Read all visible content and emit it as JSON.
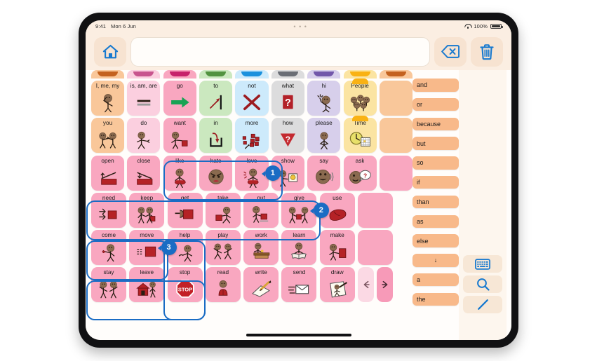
{
  "status_bar": {
    "time": "9:41",
    "date": "Mon 6 Jun",
    "center_dots": "• • •",
    "battery_percent": "100%",
    "wifi_icon": "wifi-icon",
    "battery_icon": "battery-icon"
  },
  "toolbar": {
    "home_icon": "home-icon",
    "message_value": "",
    "message_placeholder": "",
    "backspace_icon": "backspace-icon",
    "clear_icon": "trash-icon"
  },
  "tab_strip": [
    {
      "name": "pronouns",
      "body": "#f9c79a",
      "tab": "#c4621f"
    },
    {
      "name": "questions",
      "body": "#fbcfdf",
      "tab": "#c8558e"
    },
    {
      "name": "verbs",
      "body": "#f9a7c0",
      "tab": "#c7236b"
    },
    {
      "name": "prepositions",
      "body": "#cbe8bf",
      "tab": "#529340"
    },
    {
      "name": "negation",
      "body": "#cdeafb",
      "tab": "#1b91dd"
    },
    {
      "name": "questionwords",
      "body": "#dcdcdd",
      "tab": "#6a6e76"
    },
    {
      "name": "social",
      "body": "#d7cfeb",
      "tab": "#7257aa"
    },
    {
      "name": "people",
      "body": "#fbe4a2",
      "tab": "#f9b214"
    },
    {
      "name": "time",
      "body": "#f9c79a",
      "tab": "#c4621f"
    }
  ],
  "grid": {
    "rows": [
      [
        {
          "label": "I, me, my",
          "color": "#f9c79a",
          "icon": "person-pointing-self-icon"
        },
        {
          "label": "is, am, are",
          "color": "#fbcfdf",
          "icon": "equals-icon"
        },
        {
          "label": "go",
          "color": "#f9a7c0",
          "icon": "green-arrow-right-icon"
        },
        {
          "label": "to",
          "color": "#cbe8bf",
          "icon": "arrow-to-line-icon"
        },
        {
          "label": "not",
          "color": "#cdeafb",
          "icon": "red-x-icon"
        },
        {
          "label": "what",
          "color": "#dcdcdd",
          "icon": "red-question-square-icon"
        },
        {
          "label": "hi",
          "color": "#d7cfeb",
          "icon": "person-waving-icon"
        },
        {
          "label": "People",
          "color": "#fbe4a2",
          "icon": "group-of-people-icon",
          "folder": true,
          "tab": "#f9b214"
        },
        {
          "label": "",
          "color": "#f9c79a",
          "icon": "",
          "partial": true
        }
      ],
      [
        {
          "label": "you",
          "color": "#f9c79a",
          "icon": "two-people-pointing-icon"
        },
        {
          "label": "do",
          "color": "#fbcfdf",
          "icon": "person-doing-icon"
        },
        {
          "label": "want",
          "color": "#f9a7c0",
          "icon": "person-wanting-block-icon"
        },
        {
          "label": "in",
          "color": "#cbe8bf",
          "icon": "arrow-into-container-icon"
        },
        {
          "label": "more",
          "color": "#cdeafb",
          "icon": "more-blocks-icon"
        },
        {
          "label": "how",
          "color": "#dcdcdd",
          "icon": "red-question-triangle-icon"
        },
        {
          "label": "please",
          "color": "#d7cfeb",
          "icon": "person-pleading-icon"
        },
        {
          "label": "Time",
          "color": "#fbe4a2",
          "icon": "clock-calendar-icon",
          "folder": true,
          "tab": "#f9b214"
        },
        {
          "label": "",
          "color": "#f9c79a",
          "icon": "",
          "partial": true
        }
      ],
      [
        {
          "label": "open",
          "color": "#f9a7c0",
          "icon": "open-box-lid-icon"
        },
        {
          "label": "close",
          "color": "#f9a7c0",
          "icon": "close-box-lid-icon"
        },
        {
          "label": "like",
          "color": "#f9a7c0",
          "icon": "person-hugging-heart-icon"
        },
        {
          "label": "hate",
          "color": "#f9a7c0",
          "icon": "angry-face-icon"
        },
        {
          "label": "love",
          "color": "#f9a7c0",
          "icon": "person-loving-icon"
        },
        {
          "label": "show",
          "color": "#f9a7c0",
          "icon": "person-showing-picture-icon",
          "badge": "1"
        },
        {
          "label": "say",
          "color": "#f9a7c0",
          "icon": "face-talking-icon"
        },
        {
          "label": "ask",
          "color": "#f9a7c0",
          "icon": "face-question-bubble-icon"
        },
        {
          "label": "",
          "color": "#f9a7c0",
          "icon": "",
          "partial": true
        }
      ],
      [
        {
          "label": "need",
          "color": "#f9a7c0",
          "icon": "hands-reaching-block-icon"
        },
        {
          "label": "keep",
          "color": "#f9a7c0",
          "icon": "two-people-keeping-icon"
        },
        {
          "label": "get",
          "color": "#f9a7c0",
          "icon": "hand-grabbing-block-icon"
        },
        {
          "label": "take",
          "color": "#f9a7c0",
          "icon": "person-taking-block-icon"
        },
        {
          "label": "put",
          "color": "#f9a7c0",
          "icon": "person-putting-block-icon"
        },
        {
          "label": "give",
          "color": "#f9a7c0",
          "icon": "two-people-giving-icon"
        },
        {
          "label": "use",
          "color": "#f9a7c0",
          "icon": "hand-using-icon",
          "badge": "2"
        },
        {
          "label": "",
          "color": "#f9a7c0",
          "icon": "",
          "partial": true
        }
      ],
      [
        {
          "label": "come",
          "color": "#f9a7c0",
          "icon": "person-beckoning-icon"
        },
        {
          "label": "move",
          "color": "#f9a7c0",
          "icon": "block-moving-icon"
        },
        {
          "label": "help",
          "color": "#f9a7c0",
          "icon": "person-helping-icon",
          "badge": "3"
        },
        {
          "label": "play",
          "color": "#f9a7c0",
          "icon": "two-people-playing-icon"
        },
        {
          "label": "work",
          "color": "#f9a7c0",
          "icon": "person-at-desk-icon"
        },
        {
          "label": "learn",
          "color": "#f9a7c0",
          "icon": "person-reading-book-icon"
        },
        {
          "label": "make",
          "color": "#f9a7c0",
          "icon": "person-making-block-icon"
        },
        {
          "label": "",
          "color": "#f9a7c0",
          "icon": "",
          "partial": true
        }
      ],
      [
        {
          "label": "stay",
          "color": "#f9a7c0",
          "icon": "two-people-staying-icon"
        },
        {
          "label": "leave",
          "color": "#f9a7c0",
          "icon": "person-leaving-house-icon"
        },
        {
          "label": "stop",
          "color": "#f9a7c0",
          "icon": "stop-sign-icon"
        },
        {
          "label": "read",
          "color": "#f9a7c0",
          "icon": "person-reading-icon"
        },
        {
          "label": "write",
          "color": "#f9a7c0",
          "icon": "hand-writing-pencil-icon"
        },
        {
          "label": "send",
          "color": "#f9a7c0",
          "icon": "envelope-sending-icon"
        },
        {
          "label": "draw",
          "color": "#f9a7c0",
          "icon": "paper-drawing-icon"
        }
      ]
    ],
    "nav": {
      "prev_icon": "arrow-left-icon",
      "next_icon": "arrow-right-icon",
      "prev_color": "#fbd9e4",
      "next_color": "#f79ab8"
    },
    "selection_color": "#1a6cc4"
  },
  "right_column": {
    "chips": [
      {
        "label": "and"
      },
      {
        "label": "or"
      },
      {
        "label": "because"
      },
      {
        "label": "but"
      },
      {
        "label": "so"
      },
      {
        "label": "if"
      },
      {
        "label": "than"
      },
      {
        "label": "as"
      },
      {
        "label": "else"
      },
      {
        "label": "↓",
        "center": true,
        "icon": "arrow-down-icon"
      },
      {
        "label": "a"
      },
      {
        "label": "the"
      }
    ],
    "chip_color": "#f8b98a"
  },
  "tool_column": {
    "buttons": [
      {
        "name": "keyboard-icon"
      },
      {
        "name": "search-icon"
      },
      {
        "name": "pencil-icon"
      }
    ]
  }
}
